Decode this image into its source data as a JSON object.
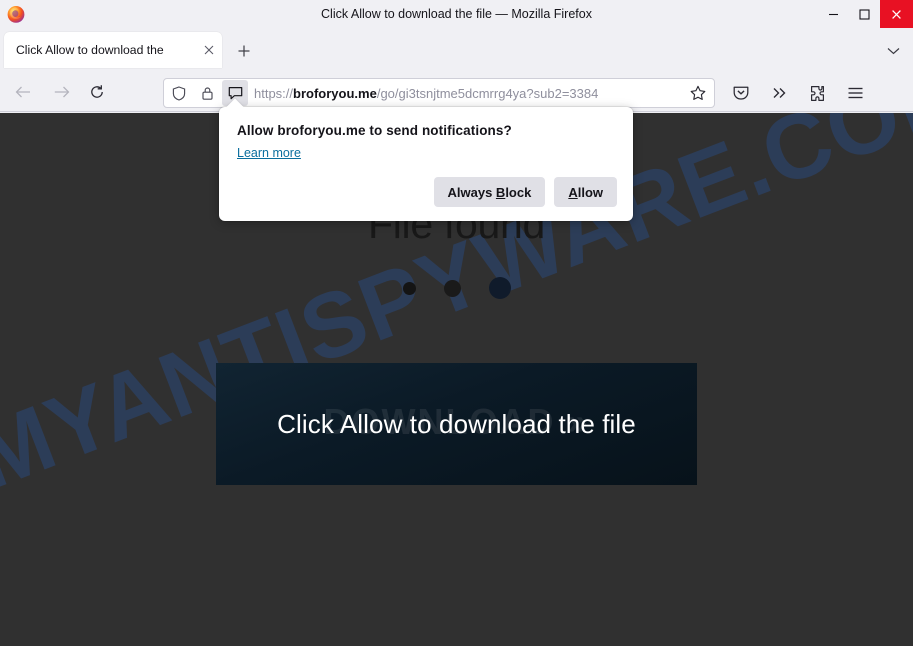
{
  "window": {
    "title": "Click Allow to download the file — Mozilla Firefox",
    "logo_icon": "firefox-logo-icon",
    "minimize_label": "—",
    "maximize_label": "□",
    "close_label": "✕"
  },
  "tabs": {
    "items": [
      {
        "label": "Click Allow to download the",
        "close_label": "✕"
      }
    ],
    "new_tab_label": "+",
    "list_all_tabs_icon": "chevron-down-icon"
  },
  "toolbar": {
    "back_icon": "arrow-left-icon",
    "forward_icon": "arrow-right-icon",
    "reload_icon": "reload-icon",
    "shield_icon": "shield-icon",
    "lock_icon": "padlock-icon",
    "notification_permission_icon": "speech-bubble-icon",
    "bookmark_icon": "star-outline-icon",
    "pocket_icon": "pocket-icon",
    "overflow_icon": "chevron-double-right-icon",
    "extensions_icon": "puzzle-piece-icon",
    "menu_icon": "hamburger-menu-icon"
  },
  "address_bar": {
    "url_host": "broforyou.me",
    "url_scheme": "https://",
    "url_path": "/go/gi3tsnjtme5dcmrrg4ya?sub2=3384",
    "url_truncated_suffix": "…"
  },
  "permission_popup": {
    "title": "Allow broforyou.me to send notifications?",
    "learn_more": "Learn more",
    "always_block": {
      "prefix": "Always ",
      "accesskey": "B",
      "suffix": "lock"
    },
    "allow": {
      "prefix": "",
      "accesskey": "A",
      "suffix": "llow"
    }
  },
  "page": {
    "watermark": "MYANTISPYWARE.COM",
    "heading": "File found",
    "loading_dots": 3,
    "download_ghost_label": "DOWNLOAD »",
    "download_label": "Click Allow to download the file"
  },
  "colors": {
    "page_background": "#303030",
    "download_box": "#0b1a26",
    "watermark": "#2b4572",
    "close_button": "#e81123",
    "link": "#0a6e9e",
    "toolbar_background": "#f0f0f4"
  }
}
